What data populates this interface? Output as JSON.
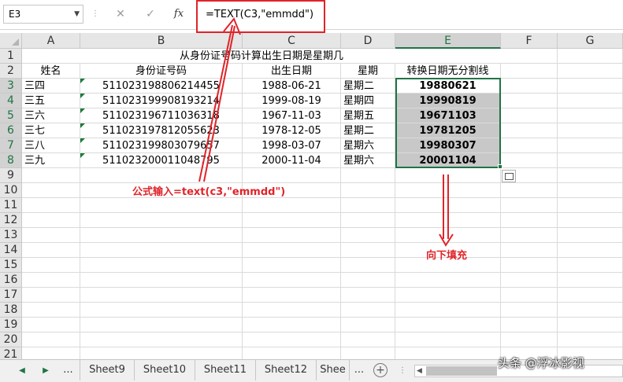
{
  "formula_bar": {
    "name_box": "E3",
    "cancel_icon": "✕",
    "enter_icon": "✓",
    "fx_label": "fx",
    "formula": "=TEXT(C3,\"emmdd\")"
  },
  "columns": [
    "A",
    "B",
    "C",
    "D",
    "E",
    "F",
    "G"
  ],
  "rows": [
    "1",
    "2",
    "3",
    "4",
    "5",
    "6",
    "7",
    "8",
    "9",
    "10",
    "11",
    "12",
    "13",
    "14",
    "15",
    "16",
    "17",
    "18",
    "19",
    "20",
    "21"
  ],
  "sheet": {
    "title": "从身份证号码计算出生日期是星期几",
    "headers": [
      "姓名",
      "身份证号码",
      "出生日期",
      "星期",
      "转换日期无分割线"
    ],
    "data": [
      [
        "三四",
        "511023198806214455",
        "1988-06-21",
        "星期二",
        "19880621"
      ],
      [
        "三五",
        "511023199908193214",
        "1999-08-19",
        "星期四",
        "19990819"
      ],
      [
        "三六",
        "511023196711036318",
        "1967-11-03",
        "星期五",
        "19671103"
      ],
      [
        "三七",
        "511023197812055623",
        "1978-12-05",
        "星期二",
        "19781205"
      ],
      [
        "三八",
        "511023199803079657",
        "1998-03-07",
        "星期六",
        "19980307"
      ],
      [
        "三九",
        "511023200011048795",
        "2000-11-04",
        "星期六",
        "20001104"
      ]
    ]
  },
  "annotations": {
    "formula_note": "公式输入=text(c3,\"emmdd\")",
    "fill_note": "向下填充",
    "color": "#e0242a"
  },
  "tabs": {
    "ellipsis": "...",
    "sheets": [
      "Sheet9",
      "Sheet10",
      "Sheet11",
      "Sheet12",
      "Shee"
    ],
    "ellipsis_right": "...",
    "add": "+"
  },
  "watermark": "头条 @浮冰影视",
  "colors": {
    "accent": "#217346",
    "annotation": "#e0242a",
    "selection": "#c8c8c8"
  }
}
